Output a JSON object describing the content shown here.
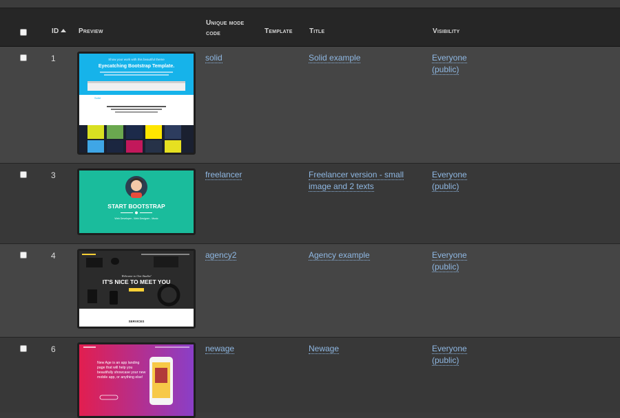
{
  "header": {
    "id": "ID",
    "preview": "Preview",
    "mode_code_line1": "Unique mode",
    "mode_code_line2": "code",
    "template": "Template",
    "title": "Title",
    "visibility": "Visibility"
  },
  "rows": [
    {
      "id": "1",
      "code": "solid",
      "title_line1": "Solid example",
      "title_line2": "",
      "vis_line1": "Everyone",
      "vis_line2": "(public)",
      "thumb": {
        "kind": "solid",
        "line1": "Show your work with this beautiful theme",
        "line2": "Eyecatching Bootstrap Template.",
        "nav": "Solid"
      }
    },
    {
      "id": "3",
      "code": "freelancer",
      "title_line1": "Freelancer version - small",
      "title_line2": "image and 2 texts",
      "vis_line1": "Everyone",
      "vis_line2": "(public)",
      "thumb": {
        "kind": "freelancer",
        "heading": "START BOOTSTRAP",
        "sub": "Web Developer - Web Designer - Music"
      }
    },
    {
      "id": "4",
      "code": "agency2",
      "title_line1": "Agency example",
      "title_line2": "",
      "vis_line1": "Everyone",
      "vis_line2": "(public)",
      "thumb": {
        "kind": "agency",
        "welcome": "Welcome to Our Studio!",
        "heading": "IT'S NICE TO MEET YOU",
        "services": "SERVICES"
      }
    },
    {
      "id": "6",
      "code": "newage",
      "title_line1": "Newage",
      "title_line2": "",
      "vis_line1": "Everyone",
      "vis_line2": "(public)",
      "thumb": {
        "kind": "newage",
        "text": "New Age is an app landing page that will help you beautifully showcase your new mobile app, or anything else!"
      }
    }
  ],
  "colors": {
    "link": "#8fb8e3",
    "header_bg": "#262626",
    "row_odd": "#454545",
    "row_even": "#383838"
  }
}
